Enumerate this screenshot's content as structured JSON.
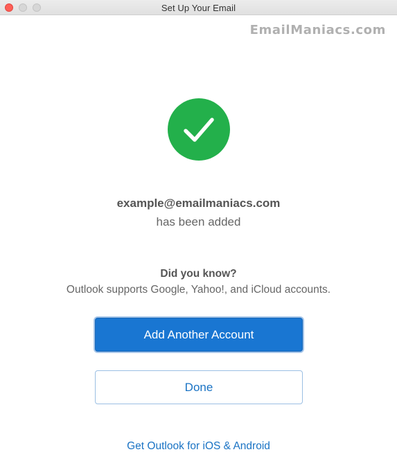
{
  "window": {
    "title": "Set Up Your Email"
  },
  "watermark": {
    "text": "EmailManiacs.com"
  },
  "status": {
    "icon": "checkmark-icon",
    "color": "#23b04b",
    "email": "example@emailmaniacs.com",
    "message": "has been added"
  },
  "tip": {
    "heading": "Did you know?",
    "text": "Outlook supports Google, Yahoo!, and iCloud accounts."
  },
  "buttons": {
    "add_account": "Add Another Account",
    "done": "Done"
  },
  "link": {
    "text": "Get Outlook for iOS & Android"
  },
  "colors": {
    "accent": "#1976d2",
    "link": "#1a73c4",
    "success": "#23b04b",
    "close": "#ff5f57"
  }
}
